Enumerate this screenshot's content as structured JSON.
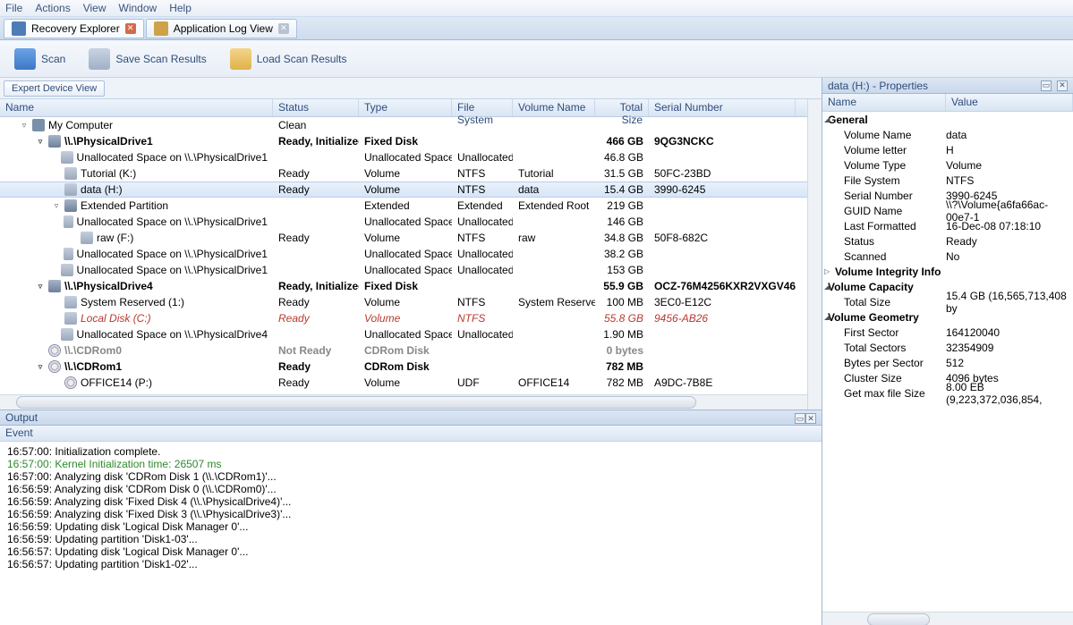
{
  "menu": {
    "file": "File",
    "actions": "Actions",
    "view": "View",
    "window": "Window",
    "help": "Help"
  },
  "tabs": {
    "recovery": "Recovery Explorer",
    "applog": "Application Log View"
  },
  "toolbar": {
    "scan": "Scan",
    "save": "Save Scan Results",
    "load": "Load Scan Results"
  },
  "expert_btn": "Expert Device View",
  "grid_headers": {
    "name": "Name",
    "status": "Status",
    "type": "Type",
    "fs": "File System",
    "vol": "Volume Name",
    "size": "Total Size",
    "serial": "Serial Number"
  },
  "rows": [
    {
      "indent": 0,
      "tw": "▿",
      "icon": "pc",
      "name": "My Computer",
      "status": "Clean",
      "bold": false
    },
    {
      "indent": 1,
      "tw": "▿",
      "icon": "hdd",
      "name": "\\\\.\\PhysicalDrive1",
      "status": "Ready, Initialized",
      "type": "Fixed Disk",
      "size": "466 GB",
      "serial": "9QG3NCKC",
      "bold": true
    },
    {
      "indent": 2,
      "icon": "part",
      "name": "Unallocated Space on \\\\.\\PhysicalDrive1",
      "type": "Unallocated Space",
      "fs": "Unallocated",
      "size": "46.8 GB"
    },
    {
      "indent": 2,
      "icon": "part",
      "name": "Tutorial (K:)",
      "status": "Ready",
      "type": "Volume",
      "fs": "NTFS",
      "vol": "Tutorial",
      "size": "31.5 GB",
      "serial": "50FC-23BD"
    },
    {
      "indent": 2,
      "icon": "part",
      "name": "data (H:)",
      "status": "Ready",
      "type": "Volume",
      "fs": "NTFS",
      "vol": "data",
      "size": "15.4 GB",
      "serial": "3990-6245",
      "sel": true
    },
    {
      "indent": 2,
      "tw": "▿",
      "icon": "hdd",
      "name": "Extended Partition",
      "type": "Extended",
      "fs": "Extended",
      "vol": "Extended Root",
      "size": "219 GB"
    },
    {
      "indent": 3,
      "icon": "part",
      "name": "Unallocated Space on \\\\.\\PhysicalDrive1",
      "type": "Unallocated Space",
      "fs": "Unallocated",
      "size": "146 GB"
    },
    {
      "indent": 3,
      "icon": "part",
      "name": "raw (F:)",
      "status": "Ready",
      "type": "Volume",
      "fs": "NTFS",
      "vol": "raw",
      "size": "34.8 GB",
      "serial": "50F8-682C"
    },
    {
      "indent": 3,
      "icon": "part",
      "name": "Unallocated Space on \\\\.\\PhysicalDrive1",
      "type": "Unallocated Space",
      "fs": "Unallocated",
      "size": "38.2 GB"
    },
    {
      "indent": 2,
      "icon": "part",
      "name": "Unallocated Space on \\\\.\\PhysicalDrive1",
      "type": "Unallocated Space",
      "fs": "Unallocated",
      "size": "153 GB"
    },
    {
      "indent": 1,
      "tw": "▿",
      "icon": "hdd",
      "name": "\\\\.\\PhysicalDrive4",
      "status": "Ready, Initialized",
      "type": "Fixed Disk",
      "size": "55.9 GB",
      "serial": "OCZ-76M4256KXR2VXGV46",
      "bold": true
    },
    {
      "indent": 2,
      "icon": "part",
      "name": "System Reserved (1:)",
      "status": "Ready",
      "type": "Volume",
      "fs": "NTFS",
      "vol": "System Reserved",
      "size": "100 MB",
      "serial": "3EC0-E12C"
    },
    {
      "indent": 2,
      "icon": "part",
      "name": "Local Disk (C:)",
      "status": "Ready",
      "type": "Volume",
      "fs": "NTFS",
      "size": "55.8 GB",
      "serial": "9456-AB26",
      "red": true,
      "italic": true
    },
    {
      "indent": 2,
      "icon": "part",
      "name": "Unallocated Space on \\\\.\\PhysicalDrive4",
      "type": "Unallocated Space",
      "fs": "Unallocated",
      "size": "1.90 MB"
    },
    {
      "indent": 1,
      "icon": "cd",
      "name": "\\\\.\\CDRom0",
      "status": "Not Ready",
      "type": "CDRom Disk",
      "size": "0 bytes",
      "gray": true,
      "bold": true
    },
    {
      "indent": 1,
      "tw": "▿",
      "icon": "cd",
      "name": "\\\\.\\CDRom1",
      "status": "Ready",
      "type": "CDRom Disk",
      "size": "782 MB",
      "bold": true
    },
    {
      "indent": 2,
      "icon": "cd",
      "name": "OFFICE14 (P:)",
      "status": "Ready",
      "type": "Volume",
      "fs": "UDF",
      "vol": "OFFICE14",
      "size": "782 MB",
      "serial": "A9DC-7B8E"
    }
  ],
  "output_title": "Output",
  "event_label": "Event",
  "log_lines": [
    {
      "t": "16:57:00: Initialization complete."
    },
    {
      "t": "16:57:00: Kernel Initialization time: 26507 ms",
      "cls": "green"
    },
    {
      "t": "16:57:00: Analyzing disk 'CDRom Disk 1 (\\\\.\\CDRom1)'..."
    },
    {
      "t": "16:56:59: Analyzing disk 'CDRom Disk 0 (\\\\.\\CDRom0)'..."
    },
    {
      "t": "16:56:59: Analyzing disk 'Fixed Disk 4 (\\\\.\\PhysicalDrive4)'..."
    },
    {
      "t": "16:56:59: Analyzing disk 'Fixed Disk 3 (\\\\.\\PhysicalDrive3)'..."
    },
    {
      "t": "16:56:59: Updating disk 'Logical Disk Manager 0'..."
    },
    {
      "t": "16:56:59: Updating partition 'Disk1-03'..."
    },
    {
      "t": "16:56:57: Updating disk 'Logical Disk Manager 0'..."
    },
    {
      "t": "16:56:57: Updating partition 'Disk1-02'..."
    }
  ],
  "props_title": "data (H:) - Properties",
  "props_headers": {
    "name": "Name",
    "value": "Value"
  },
  "props": [
    {
      "cat": true,
      "n": "General"
    },
    {
      "n": "Volume Name",
      "v": "data"
    },
    {
      "n": "Volume letter",
      "v": "H"
    },
    {
      "n": "Volume Type",
      "v": "Volume"
    },
    {
      "n": "File System",
      "v": "NTFS"
    },
    {
      "n": "Serial Number",
      "v": "3990-6245"
    },
    {
      "n": "GUID Name",
      "v": "\\\\?\\Volume{a6fa66ac-00e7-1"
    },
    {
      "n": "Last Formatted",
      "v": "16-Dec-08 07:18:10"
    },
    {
      "n": "Status",
      "v": "Ready"
    },
    {
      "n": "Scanned",
      "v": "No"
    },
    {
      "catc": true,
      "n": "Volume Integrity Info"
    },
    {
      "cat": true,
      "n": "Volume Capacity"
    },
    {
      "n": "Total Size",
      "v": "15.4 GB (16,565,713,408 by"
    },
    {
      "cat": true,
      "n": "Volume Geometry"
    },
    {
      "n": "First Sector",
      "v": "164120040"
    },
    {
      "n": "Total Sectors",
      "v": "32354909"
    },
    {
      "n": "Bytes per Sector",
      "v": "512"
    },
    {
      "n": "Cluster Size",
      "v": "4096 bytes"
    },
    {
      "n": "Get max file Size",
      "v": "8.00 EB (9,223,372,036,854,"
    }
  ]
}
